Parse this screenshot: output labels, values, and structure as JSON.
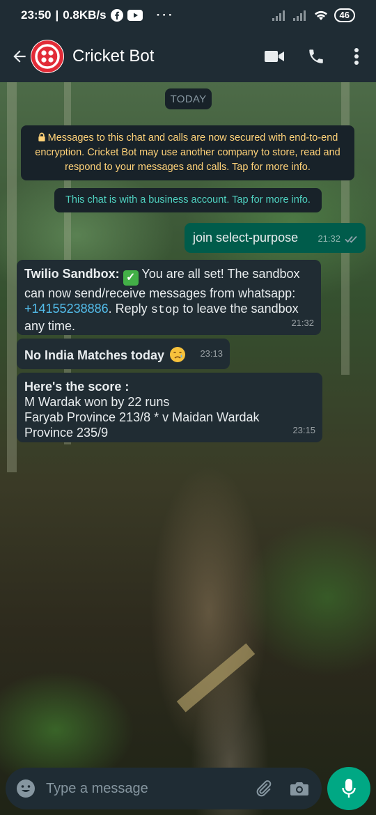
{
  "status_bar": {
    "time": "23:50",
    "network_speed": "0.8KB/s",
    "battery": "46"
  },
  "header": {
    "contact_name": "Cricket Bot"
  },
  "chat": {
    "date_label": "TODAY",
    "encryption_notice": "Messages to this chat and calls are now secured with end-to-end encryption. Cricket Bot may use another company to store, read and respond to your messages and calls. Tap for more info.",
    "business_notice": "This chat is with a business account. Tap for more info.",
    "messages": [
      {
        "direction": "outgoing",
        "text": "join select-purpose",
        "time": "21:32",
        "status": "read"
      },
      {
        "direction": "incoming",
        "sender": "Twilio Sandbox:",
        "text_a": "You are all set! The sandbox can now send/receive messages from whatsapp: ",
        "phone": "+14155238886",
        "text_b": ". Reply ",
        "code": "stop",
        "text_c": " to leave the sandbox any time.",
        "emoji": "white-heavy-check-mark",
        "time": "21:32"
      },
      {
        "direction": "incoming",
        "text": "No India Matches today",
        "emoji": "crying-face",
        "time": "23:13"
      },
      {
        "direction": "incoming",
        "title": "Here's the score :",
        "lines": [
          "M Wardak won by 22 runs",
          "Faryab Province 213/8 * v Maidan Wardak Province 235/9"
        ],
        "time": "23:15"
      }
    ]
  },
  "composer": {
    "placeholder": "Type a message"
  },
  "colors": {
    "header_bg": "#1f2c34",
    "outgoing_bubble": "#005c4b",
    "incoming_bubble": "#202c33",
    "accent": "#00a884",
    "link": "#53bdeb",
    "notice_text": "#ffd279",
    "business_notice_text": "#4fd1c0"
  },
  "icons": [
    "back-arrow-icon",
    "twilio-logo",
    "video-call-icon",
    "phone-call-icon",
    "more-vert-icon",
    "lock-icon",
    "double-check-icon",
    "emoji-icon",
    "attach-icon",
    "camera-icon",
    "mic-icon"
  ]
}
